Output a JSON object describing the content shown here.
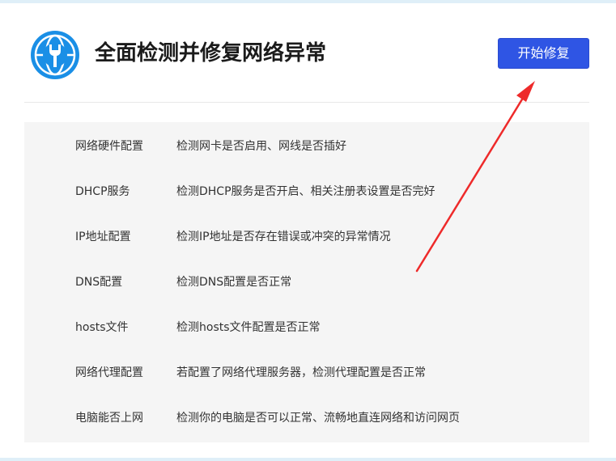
{
  "header": {
    "title": "全面检测并修复网络异常",
    "app_icon": "wrench-globe-icon",
    "start_button_label": "开始修复"
  },
  "colors": {
    "button": "#2f55e4",
    "icon_blue": "#1a8fe6",
    "panel_bg": "#f5f5f5",
    "annotation_arrow": "#ee2a2a"
  },
  "checks": [
    {
      "name": "网络硬件配置",
      "description": "检测网卡是否启用、网线是否插好"
    },
    {
      "name": "DHCP服务",
      "description": "检测DHCP服务是否开启、相关注册表设置是否完好"
    },
    {
      "name": "IP地址配置",
      "description": "检测IP地址是否存在错误或冲突的异常情况"
    },
    {
      "name": "DNS配置",
      "description": "检测DNS配置是否正常"
    },
    {
      "name": "hosts文件",
      "description": "检测hosts文件配置是否正常"
    },
    {
      "name": "网络代理配置",
      "description": "若配置了网络代理服务器，检测代理配置是否正常"
    },
    {
      "name": "电脑能否上网",
      "description": "检测你的电脑是否可以正常、流畅地直连网络和访问网页"
    }
  ]
}
